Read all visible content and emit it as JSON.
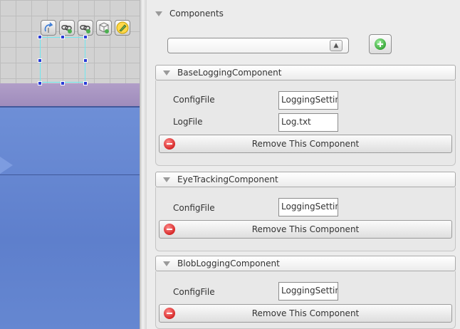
{
  "components_panel": {
    "title": "Components",
    "component_select": {
      "value": ""
    },
    "add_button_icon": "plus-circle-icon"
  },
  "components": [
    {
      "name": "BaseLoggingComponent",
      "fields": [
        {
          "label": "ConfigFile",
          "value": "LoggingSettings"
        },
        {
          "label": "LogFile",
          "value": "Log.txt"
        }
      ],
      "remove_label": "Remove This Component"
    },
    {
      "name": "EyeTrackingComponent",
      "fields": [
        {
          "label": "ConfigFile",
          "value": "LoggingSettings"
        }
      ],
      "remove_label": "Remove This Component"
    },
    {
      "name": "BlobLoggingComponent",
      "fields": [
        {
          "label": "ConfigFile",
          "value": "LoggingSettings"
        }
      ],
      "remove_label": "Remove This Component"
    }
  ],
  "canvas_tools": [
    "rotate-tool-icon",
    "link-tool-icon",
    "unlink-tool-icon",
    "cube-tool-icon",
    "edit-pencil-icon"
  ],
  "colors": {
    "remove_icon": "#d62828",
    "add_icon": "#3aa83a",
    "selection_handles": "#2a3bd6",
    "selection_border": "#6fe8f0"
  }
}
